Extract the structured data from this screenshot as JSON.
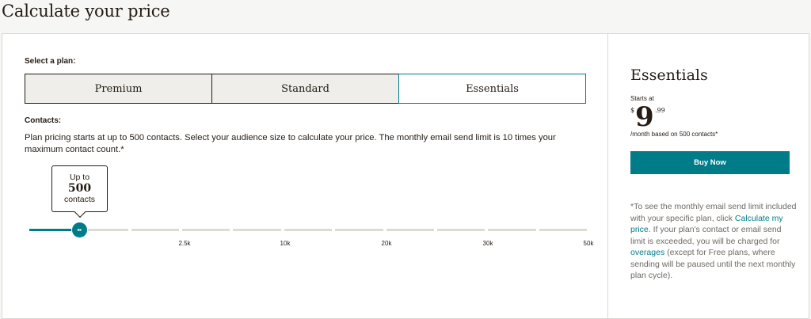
{
  "page": {
    "title": "Calculate your price"
  },
  "plan_select": {
    "label": "Select a plan:",
    "options": [
      "Premium",
      "Standard",
      "Essentials"
    ],
    "selected": "Essentials"
  },
  "contacts": {
    "label": "Contacts:",
    "description": "Plan pricing starts at up to 500 contacts. Select your audience size to calculate your price. The monthly email send limit is 10 times your maximum contact count.*",
    "tooltip": {
      "prefix": "Up to",
      "value": "500",
      "suffix": "contacts"
    },
    "slider": {
      "handle_glyph": "◂▸",
      "value": 500,
      "ticks": [
        "2.5k",
        "10k",
        "20k",
        "30k",
        "50k"
      ]
    }
  },
  "summary": {
    "plan_name": "Essentials",
    "starts_at": "Starts at",
    "currency": "$",
    "price_dollars": "9",
    "price_cents": ".99",
    "price_note": "/month based on 500 contacts*",
    "buy_button": "Buy Now",
    "footnote": {
      "part1": "*To see the monthly email send limit included with your specific plan, click ",
      "link1": "Calculate my price",
      "part2": ". If your plan's contact or email send limit is exceeded, you will be charged for ",
      "link2": "overages",
      "part3": " (except for Free plans, where sending will be paused until the next monthly plan cycle)."
    }
  },
  "colors": {
    "accent": "#007c89",
    "text": "#241c15",
    "track": "#dcdcd4"
  }
}
